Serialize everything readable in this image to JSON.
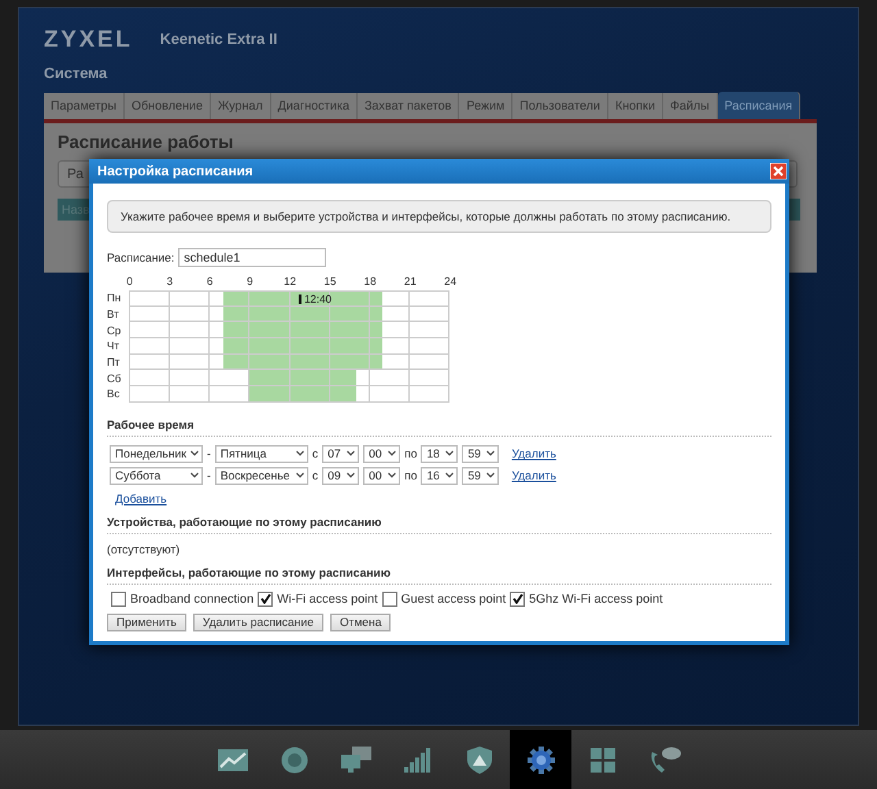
{
  "header": {
    "logo": "ZYXEL",
    "model": "Keenetic Extra II",
    "section": "Система"
  },
  "tabs": [
    {
      "label": "Параметры",
      "selected": false
    },
    {
      "label": "Обновление",
      "selected": false
    },
    {
      "label": "Журнал",
      "selected": false
    },
    {
      "label": "Диагностика",
      "selected": false
    },
    {
      "label": "Захват пакетов",
      "selected": false
    },
    {
      "label": "Режим",
      "selected": false
    },
    {
      "label": "Пользователи",
      "selected": false
    },
    {
      "label": "Кнопки",
      "selected": false
    },
    {
      "label": "Файлы",
      "selected": false
    },
    {
      "label": "Расписания",
      "selected": true
    }
  ],
  "page": {
    "title": "Расписание работы",
    "field_fragment": "Ра",
    "table_fragment": "Назв"
  },
  "dialog": {
    "title": "Настройка расписания",
    "info": "Укажите рабочее время и выберите устройства и интерфейсы, которые должны работать по этому расписанию.",
    "name_label": "Расписание:",
    "name_value": "schedule1",
    "grid": {
      "hours": [
        "0",
        "3",
        "6",
        "9",
        "12",
        "15",
        "18",
        "21",
        "24"
      ],
      "now": "12:40",
      "days": [
        {
          "label": "Пн",
          "kind": "weekday"
        },
        {
          "label": "Вт",
          "kind": "weekday"
        },
        {
          "label": "Ср",
          "kind": "weekday"
        },
        {
          "label": "Чт",
          "kind": "weekday"
        },
        {
          "label": "Пт",
          "kind": "weekday"
        },
        {
          "label": "Сб",
          "kind": "weekend"
        },
        {
          "label": "Вс",
          "kind": "weekend"
        }
      ]
    },
    "work_time": {
      "heading": "Рабочее время",
      "add": "Добавить",
      "rules": [
        {
          "kind": "weekday",
          "from_day": "Понедельник",
          "separator": "-",
          "to_day": "Пятница",
          "from_label": "с",
          "from_hour": "07",
          "from_minute": "00",
          "to_label": "по",
          "to_hour": "18",
          "to_minute": "59",
          "delete": "Удалить"
        },
        {
          "kind": "weekend",
          "from_day": "Суббота",
          "separator": "-",
          "to_day": "Воскресенье",
          "from_label": "с",
          "from_hour": "09",
          "from_minute": "00",
          "to_label": "по",
          "to_hour": "16",
          "to_minute": "59",
          "delete": "Удалить"
        }
      ]
    },
    "devices": {
      "heading": "Устройства, работающие по этому расписанию",
      "empty": "(отсутствуют)"
    },
    "interfaces": {
      "heading": "Интерфейсы, работающие по этому расписанию",
      "items": [
        {
          "label": "Broadband connection",
          "checked": false
        },
        {
          "label": "Wi-Fi access point",
          "checked": true
        },
        {
          "label": "Guest access point",
          "checked": false
        },
        {
          "label": "5Ghz Wi-Fi access point",
          "checked": true
        }
      ]
    },
    "buttons": [
      "Применить",
      "Удалить расписание",
      "Отмена"
    ]
  },
  "dock": [
    {
      "kind": "chart",
      "selected": false
    },
    {
      "kind": "globe",
      "selected": false
    },
    {
      "kind": "computers",
      "selected": false
    },
    {
      "kind": "signal",
      "selected": false
    },
    {
      "kind": "shield",
      "selected": false
    },
    {
      "kind": "gear",
      "selected": true
    },
    {
      "kind": "apps",
      "selected": false
    },
    {
      "kind": "phone",
      "selected": false
    }
  ]
}
